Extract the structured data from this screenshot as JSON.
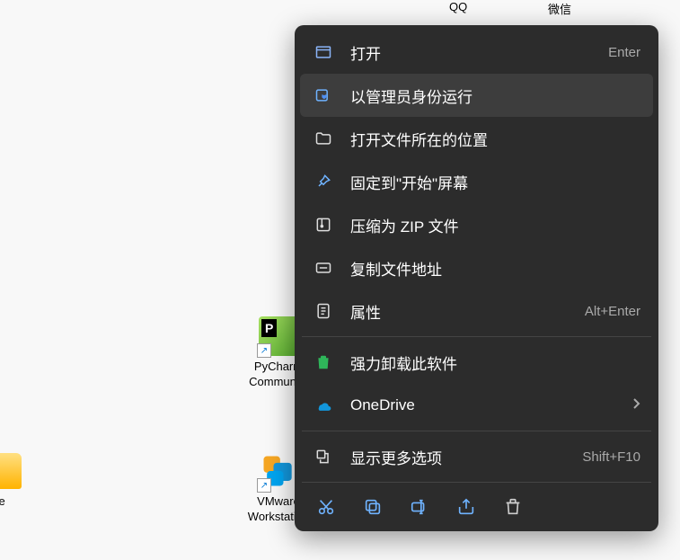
{
  "desktop_icons": {
    "pycharm": {
      "label": "PyCharm Community"
    },
    "vmware": {
      "label": "VMware Workstation"
    },
    "folder": {
      "label": "re"
    }
  },
  "menu": {
    "items": [
      {
        "label": "打开",
        "shortcut": "Enter"
      },
      {
        "label": "以管理员身份运行"
      },
      {
        "label": "打开文件所在的位置"
      },
      {
        "label": "固定到\"开始\"屏幕"
      },
      {
        "label": "压缩为 ZIP 文件"
      },
      {
        "label": "复制文件地址"
      },
      {
        "label": "属性",
        "shortcut": "Alt+Enter"
      },
      {
        "label": "强力卸载此软件"
      },
      {
        "label": "OneDrive"
      },
      {
        "label": "显示更多选项",
        "shortcut": "Shift+F10"
      }
    ]
  },
  "top_text": {
    "a": "QQ",
    "b": "微信"
  }
}
